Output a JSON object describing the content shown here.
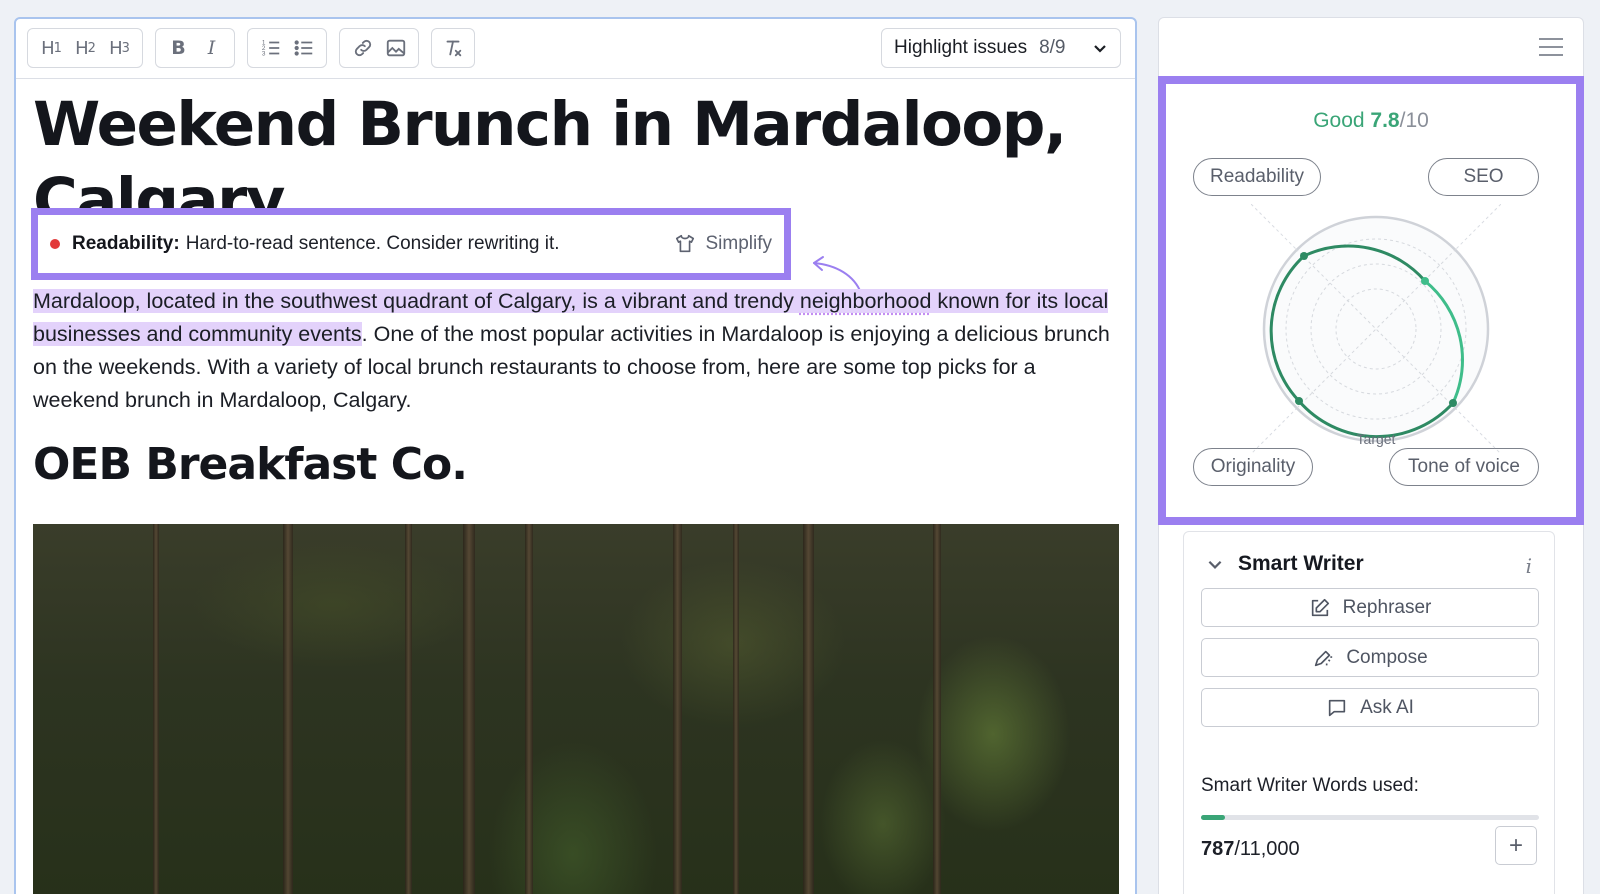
{
  "toolbar": {
    "h1": "H",
    "h1_sub": "1",
    "h2": "H",
    "h2_sub": "2",
    "h3": "H",
    "h3_sub": "3",
    "highlight_label": "Highlight issues",
    "highlight_count": "8/9"
  },
  "document": {
    "title_line1": "Weekend Brunch in Mardaloop,",
    "title_line2": "Calgary",
    "tip": {
      "label": "Readability:",
      "text": "Hard-to-read sentence. Consider rewriting it.",
      "action": "Simplify"
    },
    "paragraph": {
      "hl_part1": "Mardaloop, located in the southwest quadrant of Calgary, is a vibrant and trendy ",
      "hl_flagged": "neighborhood",
      "hl_part2": " known for its local businesses and community events",
      "rest": ". One of the most popular activities in Mardaloop is enjoying a delicious brunch on the weekends. With a variety of local brunch restaurants to choose from, here are some top picks for a weekend brunch in Mardaloop, Calgary."
    },
    "heading2": "OEB Breakfast Co."
  },
  "score": {
    "label": "Good",
    "value": "7.8",
    "max": "/10",
    "metrics": {
      "readability": "Readability",
      "seo": "SEO",
      "originality": "Originality",
      "tone": "Tone of voice"
    },
    "target_label": "Target"
  },
  "smart_writer": {
    "title": "Smart Writer",
    "info": "i",
    "rephraser": "Rephraser",
    "compose": "Compose",
    "ask_ai": "Ask AI",
    "words_label": "Smart Writer Words used:",
    "words_used": "787",
    "words_total": "/11,000",
    "words_fraction": 0.0715,
    "add": "+"
  },
  "colors": {
    "accent_purple": "#9b7ff0",
    "score_green": "#3aa577",
    "highlight": "#e3d2fb",
    "error_dot": "#e23a3a"
  }
}
